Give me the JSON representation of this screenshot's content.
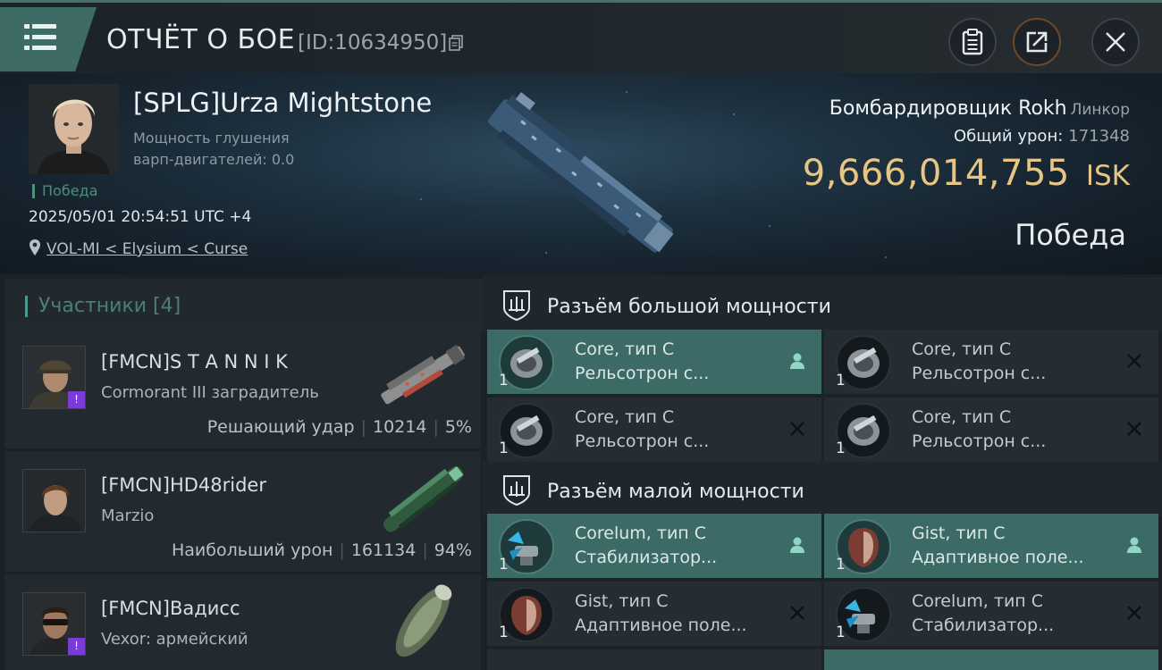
{
  "header": {
    "title": "ОТЧЁТ О БОЕ",
    "report_id": "[ID:10634950]"
  },
  "victim": {
    "name": "[SPLG]Urza Mightstone",
    "warp_label": "Мощность глушения варп-двигателей: 0.0",
    "result_tag": "Победа",
    "datetime": "2025/05/01 20:54:51 UTC +4",
    "location": "VOL-MI < Elysium < Curse",
    "ship_name": "Бомбардировщик Rokh",
    "ship_class": "Линкор",
    "total_damage_label": "Общий урон:",
    "total_damage_value": "171348",
    "isk_amount": "9,666,014,755",
    "isk_currency": "ISK",
    "result_big": "Победа"
  },
  "participants": {
    "header": "Участники [4]",
    "items": [
      {
        "name": "[FMCN]S T A N N I K",
        "ship": "Cormorant III заградитель",
        "role": "Решающий удар",
        "damage": "10214",
        "percent": "5%"
      },
      {
        "name": "[FMCN]HD48rider",
        "ship": "Marzio",
        "role": "Наибольший урон",
        "damage": "161134",
        "percent": "94%"
      },
      {
        "name": "[FMCN]Вадисс",
        "ship": "Vexor: армейский",
        "role": "",
        "damage": "",
        "percent": ""
      }
    ]
  },
  "high_slots": {
    "title": "Разъём большой мощности",
    "items": [
      {
        "line1": "Core, тип C",
        "line2": "Рельсотрон с...",
        "qty": "1",
        "status": "person-icon"
      },
      {
        "line1": "Core, тип C",
        "line2": "Рельсотрон с...",
        "qty": "1",
        "status": "close-icon"
      },
      {
        "line1": "Core, тип C",
        "line2": "Рельсотрон с...",
        "qty": "1",
        "status": "close-icon"
      },
      {
        "line1": "Core, тип C",
        "line2": "Рельсотрон с...",
        "qty": "1",
        "status": "close-icon"
      }
    ]
  },
  "low_slots": {
    "title": "Разъём малой мощности",
    "items": [
      {
        "line1": "Corelum, тип C",
        "line2": "Стабилизатор...",
        "qty": "1",
        "status": "person-icon"
      },
      {
        "line1": "Gist, тип C",
        "line2": "Адаптивное поле...",
        "qty": "1",
        "status": "person-icon"
      },
      {
        "line1": "Gist, тип C",
        "line2": "Адаптивное поле...",
        "qty": "1",
        "status": "close-icon"
      },
      {
        "line1": "Corelum, тип C",
        "line2": "Стабилизатор...",
        "qty": "1",
        "status": "close-icon"
      }
    ]
  },
  "colors": {
    "accent_teal": "#3f6b66",
    "isk_gold": "#e6c585",
    "victory_green": "#4f8e77"
  }
}
